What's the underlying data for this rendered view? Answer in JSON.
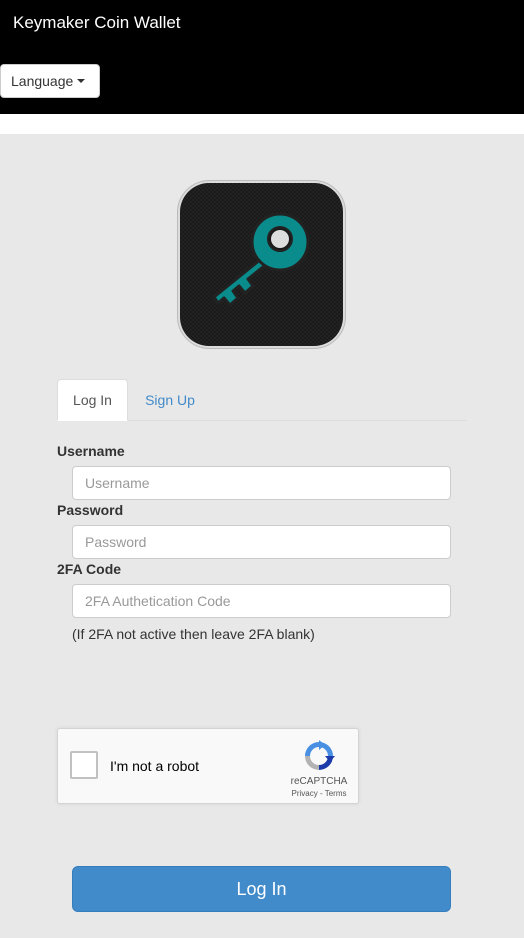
{
  "header": {
    "brand": "Keymaker Coin Wallet",
    "language_label": "Language"
  },
  "tabs": [
    {
      "label": "Log In",
      "active": true
    },
    {
      "label": "Sign Up",
      "active": false
    }
  ],
  "form": {
    "username": {
      "label": "Username",
      "value": "",
      "placeholder": "Username"
    },
    "password": {
      "label": "Password",
      "value": "",
      "placeholder": "Password"
    },
    "twofa": {
      "label": "2FA Code",
      "value": "",
      "placeholder": "2FA Authetication Code"
    },
    "twofa_help": "(If 2FA not active then leave 2FA blank)"
  },
  "captcha": {
    "label": "I'm not a robot",
    "brand": "reCAPTCHA",
    "links": "Privacy - Terms",
    "checked": false
  },
  "submit_label": "Log In",
  "colors": {
    "navbar": "#000000",
    "background": "#e8e8e8",
    "primary": "#428bca",
    "logo_key": "#0a8c8c"
  },
  "icons": {
    "logo": "key-icon",
    "language_caret": "caret-down-icon",
    "captcha": "recaptcha-icon"
  }
}
